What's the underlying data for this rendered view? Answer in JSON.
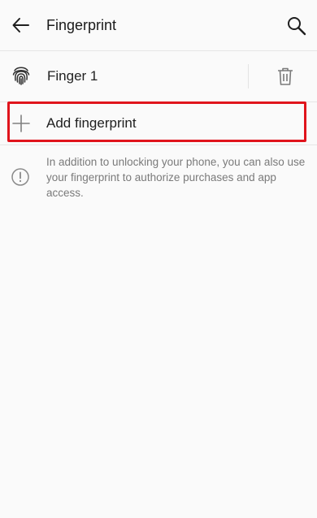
{
  "header": {
    "title": "Fingerprint",
    "back_icon": "arrow-left-icon",
    "search_icon": "search-icon"
  },
  "fingerprints": [
    {
      "label": "Finger 1",
      "icon": "fingerprint-icon",
      "action_icon": "trash-icon"
    }
  ],
  "add_row": {
    "label": "Add fingerprint",
    "icon": "plus-icon"
  },
  "info": {
    "icon": "info-icon",
    "text": "In addition to unlocking your phone, you can also use your fingerprint to authorize purchases and app access."
  },
  "colors": {
    "background": "#fafafa",
    "highlight": "#e0141c",
    "secondary_text": "#7a7a7a"
  }
}
